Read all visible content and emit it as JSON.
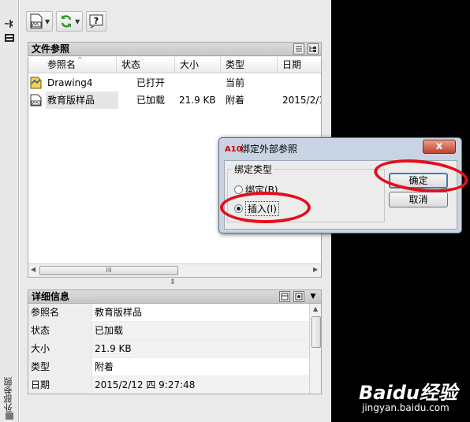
{
  "palette": {
    "side_label": "外部参照",
    "file_refs": {
      "title": "文件参照",
      "columns": [
        "参照名",
        "状态",
        "大小",
        "类型",
        "日期"
      ],
      "rows": [
        {
          "name": "Drawing4",
          "status": "已打开",
          "size": "",
          "type": "当前",
          "date": ""
        },
        {
          "name": "教育版样品",
          "status": "已加载",
          "size": "21.9 KB",
          "type": "附着",
          "date": "2015/2/1"
        }
      ],
      "scroll_grip": "III"
    },
    "details": {
      "title": "详细信息",
      "rows": [
        {
          "key": "参照名",
          "value": "教育版样品"
        },
        {
          "key": "状态",
          "value": "已加载"
        },
        {
          "key": "大小",
          "value": "21.9 KB"
        },
        {
          "key": "类型",
          "value": "附着"
        },
        {
          "key": "日期",
          "value": "2015/2/12 四 9:27:48"
        }
      ]
    }
  },
  "dialog": {
    "logo": "A10",
    "title": "绑定外部参照",
    "close": "x",
    "group_label": "绑定类型",
    "options": [
      {
        "label": "绑定(B)",
        "selected": false
      },
      {
        "label": "插入(I)",
        "selected": true
      }
    ],
    "ok_label": "确定",
    "cancel_label": "取消"
  },
  "annotation_color": "#e3101a",
  "watermark": {
    "main": "Baidu经验",
    "sub": "jingyan.baidu.com"
  }
}
